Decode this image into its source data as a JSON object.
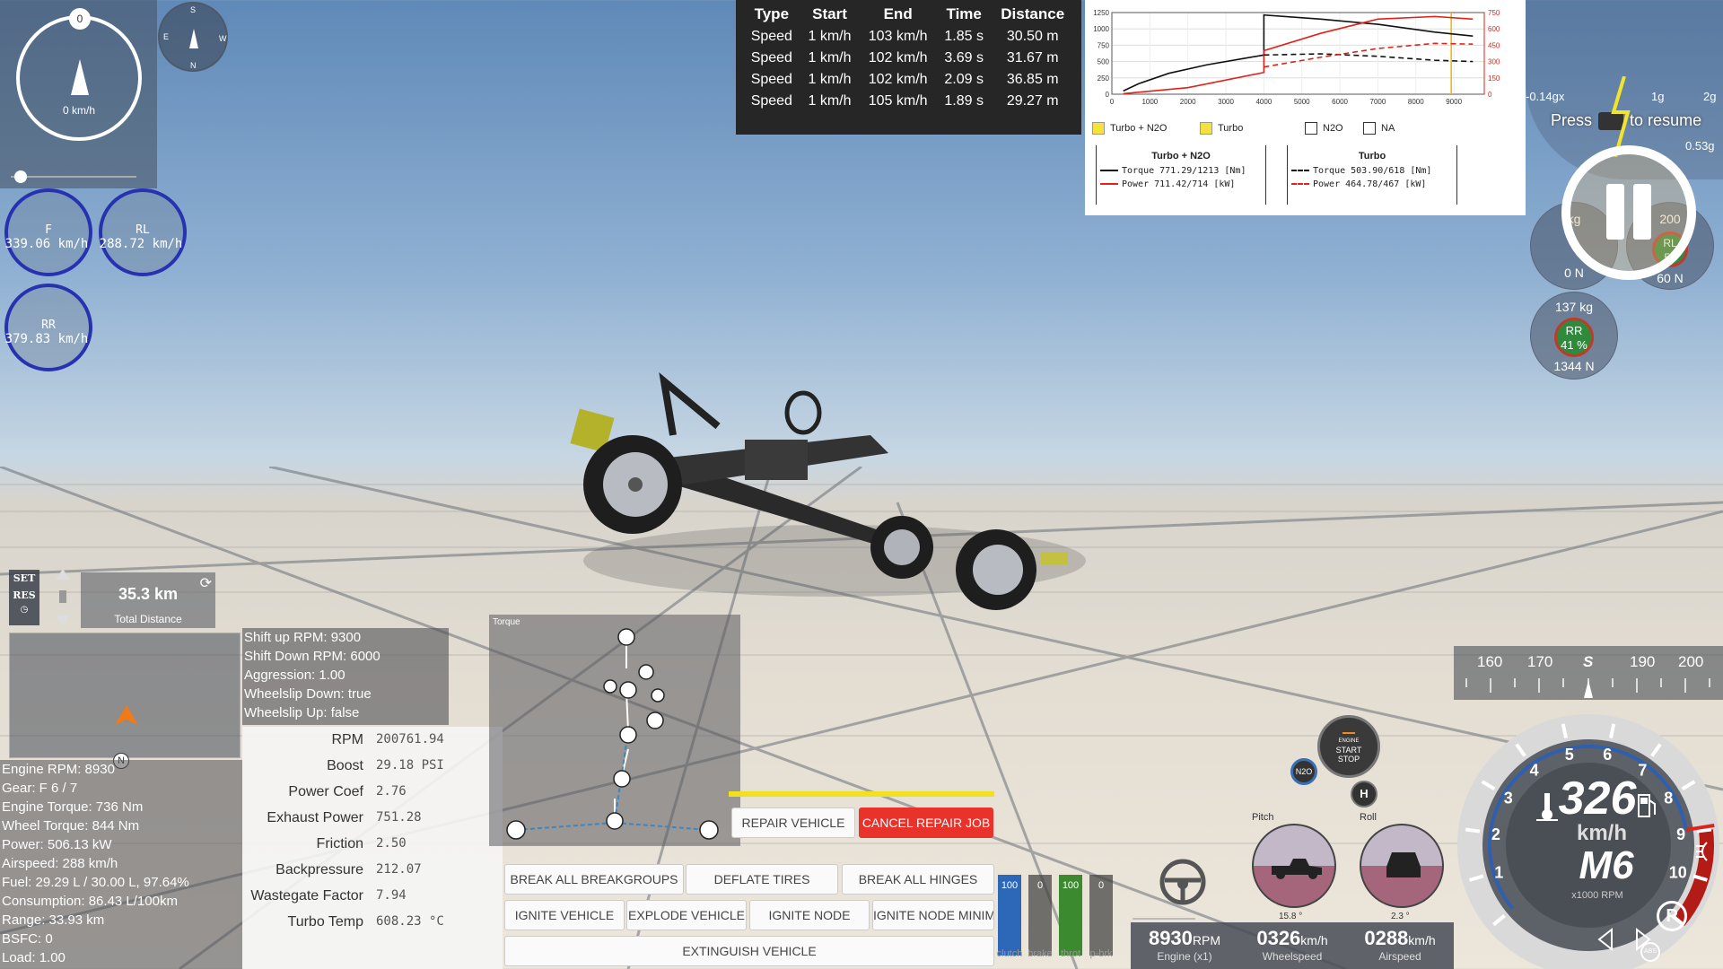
{
  "compass": {
    "value": "0",
    "speed": "0 km/h",
    "mini_letters": [
      "S",
      "E",
      "W",
      "N"
    ]
  },
  "tires_left": [
    {
      "label": "F",
      "value": "339.06 km/h"
    },
    {
      "label": "RL",
      "value": "288.72 km/h"
    },
    {
      "label": "RR",
      "value": "379.83 km/h"
    }
  ],
  "speed_table": {
    "headers": [
      "Type",
      "Start",
      "End",
      "Time",
      "Distance"
    ],
    "rows": [
      [
        "Speed",
        "1 km/h",
        "103 km/h",
        "1.85 s",
        "30.50 m"
      ],
      [
        "Speed",
        "1 km/h",
        "102 km/h",
        "3.69 s",
        "31.67 m"
      ],
      [
        "Speed",
        "1 km/h",
        "102 km/h",
        "2.09 s",
        "36.85 m"
      ],
      [
        "Speed",
        "1 km/h",
        "105 km/h",
        "1.89 s",
        "29.27 m"
      ]
    ]
  },
  "chart_data": {
    "type": "line",
    "x_ticks": [
      "0",
      "1000",
      "2000",
      "3000",
      "4000",
      "5000",
      "6000",
      "7000",
      "8000",
      "9000"
    ],
    "y_left_ticks": [
      "1250",
      "1000",
      "750",
      "500",
      "250",
      "0"
    ],
    "y_right_ticks": [
      "750",
      "600",
      "450",
      "300",
      "150",
      "0"
    ],
    "xlim": [
      0,
      9800
    ],
    "ylim_left": [
      0,
      1250
    ],
    "ylim_right": [
      0,
      750
    ],
    "series": [
      {
        "name": "Torque",
        "group": "Turbo + N2O",
        "color": "#111111",
        "dash": false,
        "axis": "left",
        "points": [
          [
            300,
            50
          ],
          [
            700,
            160
          ],
          [
            1500,
            320
          ],
          [
            2500,
            450
          ],
          [
            3500,
            550
          ],
          [
            4000,
            600
          ],
          [
            4000,
            1213
          ],
          [
            5500,
            1150
          ],
          [
            7000,
            1070
          ],
          [
            8500,
            950
          ],
          [
            9500,
            890
          ]
        ]
      },
      {
        "name": "Power",
        "group": "Turbo + N2O",
        "color": "#e0221a",
        "dash": false,
        "axis": "right",
        "points": [
          [
            300,
            5
          ],
          [
            2000,
            60
          ],
          [
            4000,
            200
          ],
          [
            4000,
            400
          ],
          [
            5500,
            560
          ],
          [
            7000,
            690
          ],
          [
            8500,
            714
          ],
          [
            9500,
            690
          ]
        ]
      },
      {
        "name": "Torque",
        "group": "Turbo",
        "color": "#111111",
        "dash": true,
        "axis": "left",
        "points": [
          [
            4000,
            600
          ],
          [
            5500,
            618
          ],
          [
            7000,
            580
          ],
          [
            8500,
            520
          ],
          [
            9500,
            500
          ]
        ]
      },
      {
        "name": "Power",
        "group": "Turbo",
        "color": "#e0221a",
        "dash": true,
        "axis": "right",
        "points": [
          [
            4000,
            250
          ],
          [
            5500,
            340
          ],
          [
            7000,
            420
          ],
          [
            8500,
            467
          ],
          [
            9500,
            460
          ]
        ]
      }
    ],
    "legend_checks": [
      {
        "label": "Turbo + N2O",
        "checked": true
      },
      {
        "label": "Turbo",
        "checked": true
      },
      {
        "label": "N2O",
        "checked": false
      },
      {
        "label": "NA",
        "checked": false
      }
    ],
    "legend_groups": [
      {
        "title": "Turbo + N2O",
        "torque": "Torque 771.29/1213 [Nm]",
        "power": "Power  711.42/714  [kW]"
      },
      {
        "title": "Turbo",
        "torque": "Torque 503.90/618 [Nm]",
        "power": "Power  464.78/467 [kW]"
      }
    ]
  },
  "gforce": {
    "left": "-0.14gx",
    "tick1": "1g",
    "tick2": "2g",
    "bottom": "0.53g",
    "press": "Press",
    "resume": "to resume"
  },
  "right_tires": [
    {
      "label": "kg",
      "top": "0",
      "bottom": "0 N"
    },
    {
      "label": "RL",
      "top": "200",
      "pct": "59",
      "bottom": "60 N"
    },
    {
      "label": "RR",
      "top": "137 kg",
      "pct": "41 %",
      "bottom": "1344 N"
    }
  ],
  "cruise": {
    "set": "SET",
    "res": "RES",
    "distance": "35.3 km",
    "distance_label": "Total Distance"
  },
  "shift": [
    "Shift up RPM: 9300",
    "Shift Down RPM: 6000",
    "Aggression: 1.00",
    "Wheelslip Down: true",
    "Wheelslip Up: false"
  ],
  "engine_info": [
    "Engine RPM: 8930",
    "Gear: F 6 / 7",
    "Engine Torque: 736 Nm",
    "Wheel Torque: 844 Nm",
    "Power: 506.13 kW",
    "Airspeed: 288 km/h",
    "Fuel: 29.29 L / 30.00 L, 97.64%",
    "Consumption: 86.43 L/100km",
    "Range: 33.93 km",
    "BSFC: 0",
    "Load: 1.00"
  ],
  "params": [
    {
      "k": "RPM",
      "v": "200761.94"
    },
    {
      "k": "Boost",
      "v": "29.18 PSI"
    },
    {
      "k": "Power Coef",
      "v": "2.76"
    },
    {
      "k": "Exhaust Power",
      "v": "751.28"
    },
    {
      "k": "Friction",
      "v": "2.50"
    },
    {
      "k": "Backpressure",
      "v": "212.07"
    },
    {
      "k": "Wastegate Factor",
      "v": "7.94"
    },
    {
      "k": "Turbo Temp",
      "v": "608.23 °C"
    }
  ],
  "torque_panel": {
    "title": "Torque"
  },
  "buttons": {
    "repair": "REPAIR VEHICLE",
    "cancel_repair": "CANCEL REPAIR JOB",
    "break_groups": "BREAK ALL BREAKGROUPS",
    "deflate": "DEFLATE TIRES",
    "break_hinges": "BREAK ALL HINGES",
    "ignite": "IGNITE VEHICLE",
    "explode": "EXPLODE VEHICLE",
    "ignite_node": "IGNITE NODE",
    "ignite_node_min": "IGNITE NODE MINIM",
    "extinguish": "EXTINGUISH VEHICLE"
  },
  "pedals": [
    {
      "value": "100",
      "label": "clutch",
      "color": "#2c67b8",
      "level": 1.0
    },
    {
      "value": "0",
      "label": "brake",
      "color": "#b03030",
      "level": 0.0
    },
    {
      "value": "100",
      "label": "throt",
      "color": "#3c8a2f",
      "level": 1.0
    },
    {
      "value": "0",
      "label": "p-brk",
      "color": "#888888",
      "level": 0.0
    }
  ],
  "readouts": [
    {
      "big": "8930",
      "unit": "RPM",
      "sub": "Engine (x1)"
    },
    {
      "big": "0326",
      "unit": "km/h",
      "sub": "Wheelspeed"
    },
    {
      "big": "0288",
      "unit": "km/h",
      "sub": "Airspeed"
    }
  ],
  "attitude": {
    "pitch_label": "Pitch",
    "roll_label": "Roll",
    "pitch_val": "15.8 °",
    "roll_val": "2.3 °"
  },
  "engine_button": {
    "l1": "ENGINE",
    "l2": "START",
    "l3": "STOP"
  },
  "n2o": "N2O",
  "heading": {
    "ticks": [
      "160",
      "170",
      "S",
      "190",
      "200"
    ]
  },
  "tacho": {
    "speed": "326",
    "unit": "km/h",
    "gear": "M6",
    "scale": "x1000 RPM",
    "numbers": [
      "1",
      "2",
      "3",
      "4",
      "5",
      "6",
      "7",
      "8",
      "9",
      "10"
    ],
    "rpm_level": 0.893,
    "abs": "ABS",
    "p": "P"
  }
}
